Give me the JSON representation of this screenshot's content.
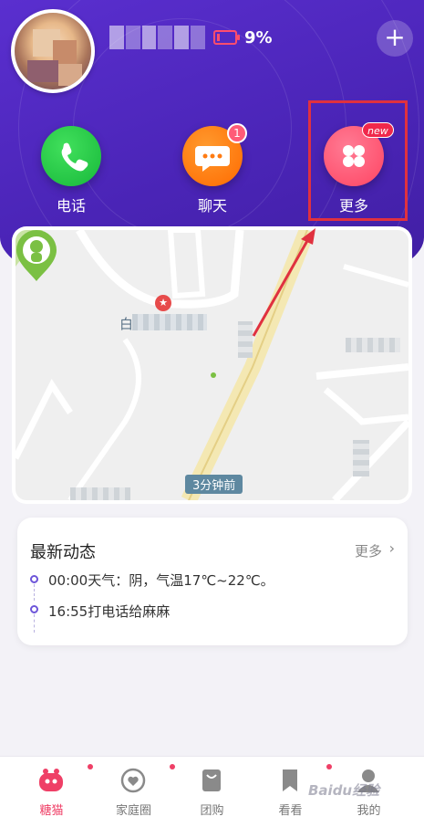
{
  "header": {
    "battery_text": "9%",
    "add_symbol": "+"
  },
  "actions": {
    "call_label": "电话",
    "chat_label": "聊天",
    "chat_badge": "1",
    "more_label": "更多",
    "more_badge": "new"
  },
  "map": {
    "poi_label": "白",
    "updated_tag": "3分钟前"
  },
  "news": {
    "title": "最新动态",
    "more_label": "更多",
    "more_arrow": "›",
    "items": [
      {
        "text": "00:00天气：阴，气温17℃~22℃。"
      },
      {
        "text": "16:55打电话给麻麻"
      }
    ]
  },
  "tabs": [
    {
      "label": "糖猫",
      "icon": "tangmao-icon",
      "active": true,
      "dot": true
    },
    {
      "label": "家庭圈",
      "icon": "heart-icon",
      "active": false,
      "dot": true
    },
    {
      "label": "团购",
      "icon": "shopping-bag-icon",
      "active": false,
      "dot": false
    },
    {
      "label": "看看",
      "icon": "bookmark-icon",
      "active": false,
      "dot": true
    },
    {
      "label": "我的",
      "icon": "profile-icon",
      "active": false,
      "dot": false
    }
  ],
  "watermark": "Baidu经验",
  "colors": {
    "header_purple": "#4a24b6",
    "accent_pink": "#ef3f66",
    "call_green": "#17b83a",
    "chat_orange": "#ff6a00",
    "more_red": "#ff4462",
    "highlight_red": "#e0313f"
  }
}
